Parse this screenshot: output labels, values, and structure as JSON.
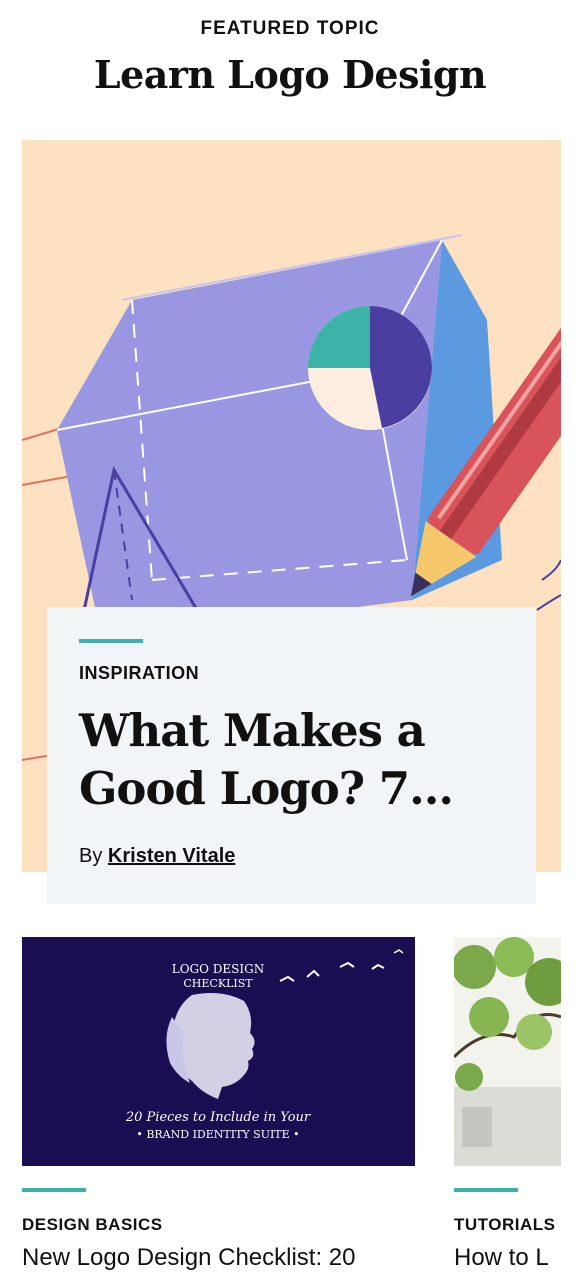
{
  "featured": {
    "eyebrow": "FEATURED TOPIC",
    "title": "Learn Logo Design"
  },
  "hero_card": {
    "category": "INSPIRATION",
    "title": "What Makes a Good Logo? 7...",
    "by_label": "By",
    "author": "Kristen Vitale"
  },
  "articles": [
    {
      "thumb": {
        "line1": "LOGO DESIGN",
        "line2": "CHECKLIST",
        "line3": "20 Pieces to Include in Your",
        "line4": "• BRAND IDENTITY SUITE •"
      },
      "category": "DESIGN BASICS",
      "title": "New Logo Design Checklist: 20"
    },
    {
      "category": "TUTORIALS",
      "title": "How to L"
    }
  ],
  "colors": {
    "accent": "#3bb3a9",
    "hero_bg": "#fde1c0",
    "card_bg": "#f2f5f8",
    "thumb_bg": "#1a0d52"
  }
}
